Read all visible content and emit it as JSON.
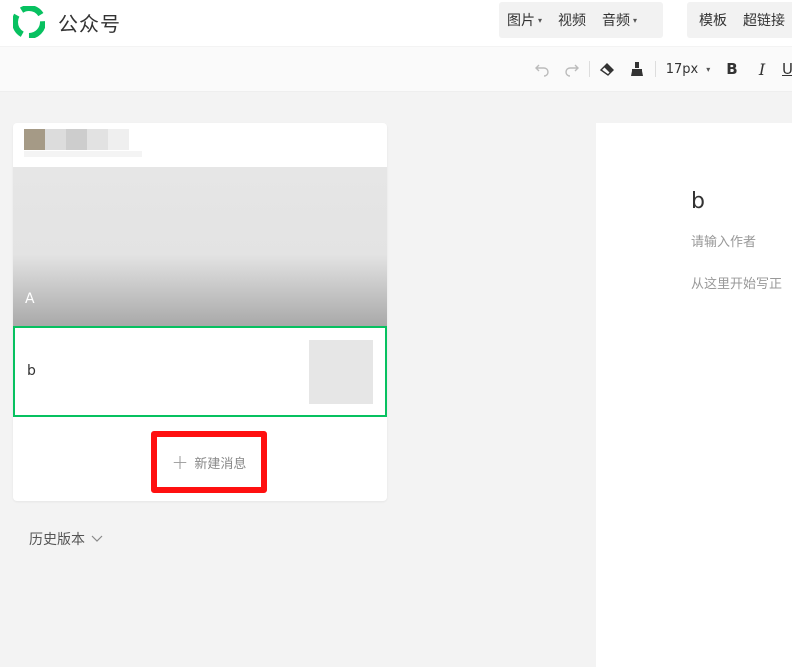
{
  "header": {
    "app_title": "公众号",
    "brand_color": "#07c160",
    "group1": [
      {
        "label": "图片",
        "has_caret": true
      },
      {
        "label": "视频",
        "has_caret": false
      },
      {
        "label": "音频",
        "has_caret": true
      }
    ],
    "group2": [
      {
        "label": "模板"
      },
      {
        "label": "超链接"
      }
    ]
  },
  "toolbar": {
    "undo_icon": "undo-icon",
    "redo_icon": "redo-icon",
    "clear_format_icon": "eraser-icon",
    "format_painter_icon": "format-brush-icon",
    "font_size": "17px",
    "bold_label": "B",
    "italic_label": "I",
    "underline_label": "U"
  },
  "left_panel": {
    "cover_title": "A",
    "item_b_title": "b",
    "new_message_label": "新建消息",
    "new_message_icon": "plus-icon",
    "highlight_color": "#ff1010",
    "history_label": "历史版本"
  },
  "editor": {
    "title": "b",
    "author_placeholder": "请输入作者",
    "body_placeholder": "从这里开始写正"
  }
}
